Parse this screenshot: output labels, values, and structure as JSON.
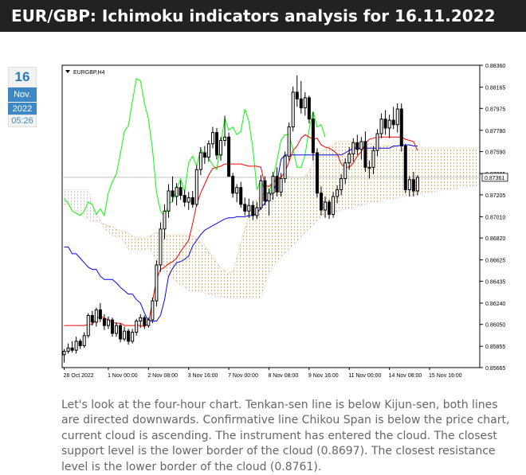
{
  "header": {
    "title": "EUR/GBP: Ichimoku indicators analysis for 16.11.2022"
  },
  "date_badge": {
    "day": "16",
    "month": "Nov.",
    "year": "2022",
    "time": "05:26"
  },
  "description": "Let's look at the four-hour chart. Tenkan-sen line is below Kijun-sen, both lines are directed downwards. Confirmative line Chikou Span is below the price chart, current cloud is ascending. The instrument has entered the cloud. The closest support level is the lower border of the cloud (0.8697). The closest resistance level is the lower border of the cloud (0.8761).",
  "colors": {
    "tenkan": "#ff0000",
    "kijun": "#0000ff",
    "chikou": "#00ff00",
    "cloud_up": "#f4a460",
    "cloud_down": "#d8bfd8",
    "candle": "#000000",
    "current_price_line": "#c0c0c0"
  },
  "chart_data": {
    "type": "candlestick",
    "symbol_label": "EURGBP,H4",
    "current_price": 0.87361,
    "current_price_label": "0.87361",
    "ylim": [
      0.85665,
      0.8836
    ],
    "y_ticks": [
      {
        "value": 0.8836,
        "label": "0.88360"
      },
      {
        "value": 0.88165,
        "label": "0.88165"
      },
      {
        "value": 0.87975,
        "label": "0.87975"
      },
      {
        "value": 0.8778,
        "label": "0.87780"
      },
      {
        "value": 0.8759,
        "label": "0.87590"
      },
      {
        "value": 0.87395,
        "label": "0.87395"
      },
      {
        "value": 0.87205,
        "label": "0.87205"
      },
      {
        "value": 0.8701,
        "label": "0.87010"
      },
      {
        "value": 0.8682,
        "label": "0.86820"
      },
      {
        "value": 0.86625,
        "label": "0.86625"
      },
      {
        "value": 0.86435,
        "label": "0.86435"
      },
      {
        "value": 0.8624,
        "label": "0.86240"
      },
      {
        "value": 0.8605,
        "label": "0.86050"
      },
      {
        "value": 0.85855,
        "label": "0.85855"
      },
      {
        "value": 0.85665,
        "label": "0.85665"
      }
    ],
    "x_ticks": [
      {
        "index": 0,
        "label": "28 Oct 2022"
      },
      {
        "index": 11,
        "label": "1 Nov 00:00"
      },
      {
        "index": 21,
        "label": "2 Nov 08:00"
      },
      {
        "index": 31,
        "label": "3 Nov 16:00"
      },
      {
        "index": 41,
        "label": "7 Nov 00:00"
      },
      {
        "index": 51,
        "label": "8 Nov 08:00"
      },
      {
        "index": 61,
        "label": "9 Nov 16:00"
      },
      {
        "index": 71,
        "label": "11 Nov 00:00"
      },
      {
        "index": 81,
        "label": "14 Nov 08:00"
      },
      {
        "index": 91,
        "label": "15 Nov 16:00"
      }
    ],
    "total_slots": 104,
    "candles": [
      [
        0.8578,
        0.8583,
        0.8571,
        0.8581
      ],
      [
        0.8581,
        0.8588,
        0.8579,
        0.8584
      ],
      [
        0.8584,
        0.859,
        0.858,
        0.8582
      ],
      [
        0.8582,
        0.8594,
        0.8579,
        0.859
      ],
      [
        0.859,
        0.8592,
        0.8583,
        0.8586
      ],
      [
        0.8586,
        0.8598,
        0.8584,
        0.8595
      ],
      [
        0.8595,
        0.8615,
        0.8593,
        0.8613
      ],
      [
        0.8613,
        0.8617,
        0.8604,
        0.8607
      ],
      [
        0.8607,
        0.862,
        0.8603,
        0.8618
      ],
      [
        0.8618,
        0.8624,
        0.8607,
        0.861
      ],
      [
        0.861,
        0.8614,
        0.86,
        0.8604
      ],
      [
        0.8604,
        0.8612,
        0.8601,
        0.8609
      ],
      [
        0.8609,
        0.8611,
        0.8594,
        0.8597
      ],
      [
        0.8597,
        0.8607,
        0.8594,
        0.8604
      ],
      [
        0.8604,
        0.8606,
        0.8589,
        0.8592
      ],
      [
        0.8592,
        0.8603,
        0.859,
        0.8599
      ],
      [
        0.8599,
        0.8601,
        0.8587,
        0.859
      ],
      [
        0.859,
        0.8601,
        0.8588,
        0.8598
      ],
      [
        0.8598,
        0.861,
        0.8595,
        0.8608
      ],
      [
        0.8608,
        0.8614,
        0.8602,
        0.8611
      ],
      [
        0.8611,
        0.8613,
        0.8601,
        0.8604
      ],
      [
        0.8604,
        0.8611,
        0.8602,
        0.8609
      ],
      [
        0.8609,
        0.8629,
        0.8606,
        0.8626
      ],
      [
        0.8626,
        0.8662,
        0.8621,
        0.8658
      ],
      [
        0.8658,
        0.8696,
        0.8652,
        0.869
      ],
      [
        0.869,
        0.8712,
        0.8681,
        0.8706
      ],
      [
        0.8706,
        0.873,
        0.87,
        0.8724
      ],
      [
        0.8724,
        0.8737,
        0.8714,
        0.8719
      ],
      [
        0.8719,
        0.8731,
        0.8711,
        0.8727
      ],
      [
        0.8727,
        0.8733,
        0.8716,
        0.872
      ],
      [
        0.872,
        0.8725,
        0.871,
        0.8714
      ],
      [
        0.8714,
        0.8723,
        0.8707,
        0.8718
      ],
      [
        0.8718,
        0.8724,
        0.8709,
        0.8712
      ],
      [
        0.8712,
        0.8747,
        0.871,
        0.8743
      ],
      [
        0.8743,
        0.8763,
        0.8738,
        0.8758
      ],
      [
        0.8758,
        0.8764,
        0.8748,
        0.8754
      ],
      [
        0.8754,
        0.8769,
        0.875,
        0.8766
      ],
      [
        0.8766,
        0.8781,
        0.8762,
        0.8776
      ],
      [
        0.8776,
        0.878,
        0.8752,
        0.8756
      ],
      [
        0.8756,
        0.8772,
        0.8751,
        0.8769
      ],
      [
        0.8769,
        0.8791,
        0.8764,
        0.8772
      ],
      [
        0.8772,
        0.8776,
        0.8742,
        0.8737
      ],
      [
        0.8737,
        0.874,
        0.8718,
        0.8722
      ],
      [
        0.8722,
        0.873,
        0.8714,
        0.8727
      ],
      [
        0.8727,
        0.8732,
        0.8709,
        0.8712
      ],
      [
        0.8712,
        0.8718,
        0.8702,
        0.8706
      ],
      [
        0.8706,
        0.8717,
        0.87,
        0.8711
      ],
      [
        0.8711,
        0.8715,
        0.8698,
        0.8702
      ],
      [
        0.8702,
        0.8714,
        0.8699,
        0.8709
      ],
      [
        0.8709,
        0.8738,
        0.8707,
        0.8733
      ],
      [
        0.8733,
        0.8737,
        0.8711,
        0.8715
      ],
      [
        0.8715,
        0.8726,
        0.8702,
        0.8722
      ],
      [
        0.8722,
        0.8741,
        0.8716,
        0.8737
      ],
      [
        0.8737,
        0.8745,
        0.8719,
        0.8723
      ],
      [
        0.8723,
        0.874,
        0.8719,
        0.8735
      ],
      [
        0.8735,
        0.8759,
        0.8731,
        0.8755
      ],
      [
        0.8755,
        0.8785,
        0.8751,
        0.8781
      ],
      [
        0.8781,
        0.8817,
        0.8777,
        0.8812
      ],
      [
        0.8812,
        0.8827,
        0.8799,
        0.8806
      ],
      [
        0.8806,
        0.8822,
        0.8793,
        0.8798
      ],
      [
        0.8798,
        0.8812,
        0.8791,
        0.8807
      ],
      [
        0.8807,
        0.8809,
        0.8784,
        0.8788
      ],
      [
        0.8788,
        0.8794,
        0.8751,
        0.8758
      ],
      [
        0.8758,
        0.8762,
        0.8718,
        0.8722
      ],
      [
        0.8722,
        0.8728,
        0.8702,
        0.8707
      ],
      [
        0.8707,
        0.8719,
        0.87,
        0.8714
      ],
      [
        0.8714,
        0.8716,
        0.8699,
        0.8703
      ],
      [
        0.8703,
        0.8723,
        0.87,
        0.8719
      ],
      [
        0.8719,
        0.8729,
        0.8713,
        0.8725
      ],
      [
        0.8725,
        0.8739,
        0.872,
        0.8735
      ],
      [
        0.8735,
        0.8753,
        0.873,
        0.8749
      ],
      [
        0.8749,
        0.8763,
        0.8743,
        0.8757
      ],
      [
        0.8757,
        0.8771,
        0.875,
        0.8767
      ],
      [
        0.8767,
        0.8774,
        0.8756,
        0.8761
      ],
      [
        0.8761,
        0.8772,
        0.8752,
        0.8768
      ],
      [
        0.8768,
        0.8777,
        0.8741,
        0.8745
      ],
      [
        0.8745,
        0.8751,
        0.8735,
        0.8745
      ],
      [
        0.8745,
        0.8764,
        0.8739,
        0.876
      ],
      [
        0.876,
        0.8779,
        0.8755,
        0.8775
      ],
      [
        0.8775,
        0.8793,
        0.8771,
        0.8788
      ],
      [
        0.8788,
        0.8796,
        0.8774,
        0.878
      ],
      [
        0.878,
        0.8792,
        0.8771,
        0.8787
      ],
      [
        0.8787,
        0.8799,
        0.8779,
        0.8783
      ],
      [
        0.8783,
        0.8802,
        0.8776,
        0.8797
      ],
      [
        0.8797,
        0.8802,
        0.8759,
        0.8764
      ],
      [
        0.8764,
        0.8766,
        0.8722,
        0.8725
      ],
      [
        0.8725,
        0.8737,
        0.8719,
        0.8734
      ],
      [
        0.8734,
        0.8741,
        0.8719,
        0.8724
      ],
      [
        0.8724,
        0.8738,
        0.872,
        0.8736
      ]
    ],
    "tenkan": [
      0.8604,
      0.8604,
      0.8604,
      0.8604,
      0.8604,
      0.8604,
      0.8605,
      0.8605,
      0.861,
      0.8612,
      0.8611,
      0.8609,
      0.8607,
      0.8606,
      0.8606,
      0.8604,
      0.8604,
      0.8604,
      0.8604,
      0.8604,
      0.8603,
      0.8606,
      0.8626,
      0.8645,
      0.8654,
      0.8656,
      0.8659,
      0.8661,
      0.8664,
      0.867,
      0.8675,
      0.868,
      0.8695,
      0.8712,
      0.8722,
      0.873,
      0.8738,
      0.8744,
      0.8745,
      0.8746,
      0.8748,
      0.8748,
      0.8748,
      0.8748,
      0.8748,
      0.8747,
      0.8746,
      0.8746,
      0.8746,
      0.8745,
      0.8729,
      0.8728,
      0.8731,
      0.8735,
      0.8736,
      0.8741,
      0.875,
      0.876,
      0.8764,
      0.8771,
      0.8774,
      0.8772,
      0.877,
      0.8771,
      0.8765,
      0.8763,
      0.8762,
      0.876,
      0.8757,
      0.8748,
      0.8745,
      0.8745,
      0.8749,
      0.8755,
      0.8759,
      0.8766,
      0.877,
      0.8771,
      0.8772,
      0.8772,
      0.8772,
      0.8772,
      0.8772,
      0.8772,
      0.8772,
      0.877,
      0.8769,
      0.8768,
      0.876
    ],
    "kijun": [
      0.8674,
      0.8674,
      0.8668,
      0.8668,
      0.8664,
      0.866,
      0.8656,
      0.8654,
      0.8654,
      0.8648,
      0.8645,
      0.8645,
      0.8645,
      0.8642,
      0.8638,
      0.8635,
      0.8632,
      0.8632,
      0.8627,
      0.8624,
      0.8615,
      0.8608,
      0.8608,
      0.8608,
      0.8613,
      0.8627,
      0.8648,
      0.8655,
      0.866,
      0.8661,
      0.8663,
      0.8666,
      0.8675,
      0.868,
      0.8685,
      0.8689,
      0.8691,
      0.8693,
      0.8695,
      0.8697,
      0.8699,
      0.87,
      0.87,
      0.8701,
      0.8701,
      0.8701,
      0.8702,
      0.8702,
      0.8704,
      0.8709,
      0.8713,
      0.8718,
      0.8724,
      0.8731,
      0.8752,
      0.8756,
      0.8756,
      0.8756,
      0.8756,
      0.8756,
      0.8756,
      0.8756,
      0.8756,
      0.8756,
      0.8756,
      0.8756,
      0.8756,
      0.8756,
      0.8756,
      0.8756,
      0.8758,
      0.876,
      0.8762,
      0.8762,
      0.8762,
      0.8762,
      0.8762,
      0.8762,
      0.8762,
      0.8762,
      0.8762,
      0.8762,
      0.8764,
      0.8764,
      0.8765,
      0.8765,
      0.8765,
      0.8764,
      0.8764
    ],
    "chikou_start_index": 0,
    "chikou": [
      0.8717,
      0.8713,
      0.8706,
      0.8704,
      0.8702,
      0.8706,
      0.8714,
      0.8712,
      0.8703,
      0.8708,
      0.8702,
      0.8722,
      0.8732,
      0.8739,
      0.8757,
      0.8777,
      0.8782,
      0.8804,
      0.8824,
      0.8822,
      0.8802,
      0.8788,
      0.8761,
      0.8723,
      0.8706,
      0.8701,
      0.8712,
      0.8715,
      0.8725,
      0.8735,
      0.8723,
      0.8749,
      0.8755,
      0.8746,
      0.8761,
      0.8756,
      0.8753,
      0.8747,
      0.8743,
      0.8766,
      0.8789,
      0.8778,
      0.8781,
      0.8774,
      0.8777,
      0.8797,
      0.8786,
      0.8762,
      0.8725,
      0.8734,
      0.8724,
      0.8721,
      0.8735,
      0.8751,
      0.8769,
      0.8774,
      0.8774,
      0.8761,
      0.8745,
      0.8745,
      0.8756,
      0.8779,
      0.8795,
      0.8781,
      0.8783,
      0.8772
    ],
    "span_a": [
      0.8712,
      0.8712,
      0.8708,
      0.8706,
      0.8703,
      0.8701,
      0.8699,
      0.8697,
      0.8697,
      0.8696,
      0.8694,
      0.8693,
      0.8692,
      0.869,
      0.8688,
      0.8688,
      0.8686,
      0.8684,
      0.8682,
      0.8682,
      0.8682,
      0.8683,
      0.8685,
      0.8687,
      0.8686,
      0.8686,
      0.8684,
      0.8685,
      0.8685,
      0.8685,
      0.8685,
      0.8685,
      0.8684,
      0.8681,
      0.8678,
      0.8675,
      0.867,
      0.8665,
      0.866,
      0.8655,
      0.8653,
      0.8651,
      0.8652,
      0.8664,
      0.8678,
      0.869,
      0.8702,
      0.8712,
      0.8716,
      0.8719,
      0.8723,
      0.8729,
      0.8733,
      0.8736,
      0.8737,
      0.8737,
      0.8737,
      0.8736,
      0.8736,
      0.8736,
      0.8737,
      0.8741,
      0.8749,
      0.8756,
      0.8759,
      0.8761,
      0.8764,
      0.8765,
      0.8768,
      0.8768,
      0.8768,
      0.8768,
      0.8768,
      0.8768,
      0.8766,
      0.8766,
      0.8766,
      0.8766,
      0.8765,
      0.8765,
      0.8764,
      0.8764,
      0.8763,
      0.8763,
      0.8762,
      0.8762,
      0.8762,
      0.8762,
      0.8762,
      0.8762,
      0.8762,
      0.8762,
      0.8762,
      0.8762,
      0.8762,
      0.8762,
      0.8762,
      0.8762,
      0.8762,
      0.8762,
      0.8762,
      0.8762,
      0.8762,
      0.8762
    ],
    "span_b": [
      0.8725,
      0.8725,
      0.8725,
      0.8725,
      0.8725,
      0.8725,
      0.8725,
      0.8712,
      0.8705,
      0.8698,
      0.869,
      0.8688,
      0.8684,
      0.8683,
      0.8683,
      0.8678,
      0.8672,
      0.867,
      0.867,
      0.8671,
      0.8671,
      0.8673,
      0.8668,
      0.8662,
      0.8655,
      0.8652,
      0.8648,
      0.8646,
      0.8643,
      0.864,
      0.8638,
      0.8635,
      0.8634,
      0.8634,
      0.8634,
      0.8633,
      0.8632,
      0.8631,
      0.863,
      0.863,
      0.8629,
      0.8628,
      0.8628,
      0.8628,
      0.8628,
      0.8628,
      0.8628,
      0.8628,
      0.8628,
      0.8628,
      0.864,
      0.865,
      0.8657,
      0.866,
      0.8664,
      0.8668,
      0.8671,
      0.8675,
      0.8679,
      0.8683,
      0.8687,
      0.869,
      0.8694,
      0.8697,
      0.87,
      0.8703,
      0.8704,
      0.8705,
      0.8706,
      0.8707,
      0.8708,
      0.8708,
      0.8709,
      0.871,
      0.8711,
      0.8712,
      0.8713,
      0.8714,
      0.8714,
      0.8715,
      0.8716,
      0.8717,
      0.8717,
      0.8718,
      0.8719,
      0.8719,
      0.872,
      0.872,
      0.8721,
      0.8722,
      0.8722,
      0.8723,
      0.8723,
      0.8724,
      0.8724,
      0.8725,
      0.8725,
      0.8726,
      0.8726,
      0.8727,
      0.8727,
      0.8728,
      0.8728,
      0.8729
    ]
  }
}
